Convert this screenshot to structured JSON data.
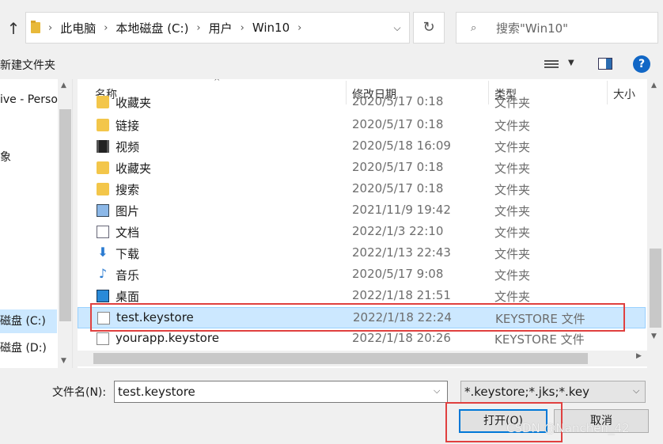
{
  "address": {
    "crumbs": [
      "此电脑",
      "本地磁盘 (C:)",
      "用户",
      "Win10"
    ]
  },
  "search": {
    "placeholder": "搜索\"Win10\""
  },
  "toolbar": {
    "new_folder": "新建文件夹"
  },
  "nav": {
    "items": [
      {
        "label": "ive - Perso"
      },
      {
        "label": "象"
      },
      {
        "label": "磁盘 (C:)",
        "selected": true
      },
      {
        "label": "磁盘 (D:)"
      }
    ]
  },
  "columns": {
    "name": "名称",
    "date": "修改日期",
    "type": "类型",
    "size": "大小"
  },
  "files": [
    {
      "name": "收藏夹",
      "date": "2020/5/17 0:18",
      "type": "文件夹",
      "icon": "folder-star-icon"
    },
    {
      "name": "链接",
      "date": "2020/5/17 0:18",
      "type": "文件夹",
      "icon": "link-folder-icon"
    },
    {
      "name": "视频",
      "date": "2020/5/18 16:09",
      "type": "文件夹",
      "icon": "video-folder-icon"
    },
    {
      "name": "收藏夹",
      "date": "2020/5/17 0:18",
      "type": "文件夹",
      "icon": "favorites-folder-icon"
    },
    {
      "name": "搜索",
      "date": "2020/5/17 0:18",
      "type": "文件夹",
      "icon": "search-folder-icon"
    },
    {
      "name": "图片",
      "date": "2021/11/9 19:42",
      "type": "文件夹",
      "icon": "pictures-folder-icon"
    },
    {
      "name": "文档",
      "date": "2022/1/3 22:10",
      "type": "文件夹",
      "icon": "documents-folder-icon"
    },
    {
      "name": "下载",
      "date": "2022/1/13 22:43",
      "type": "文件夹",
      "icon": "downloads-folder-icon"
    },
    {
      "name": "音乐",
      "date": "2020/5/17 9:08",
      "type": "文件夹",
      "icon": "music-folder-icon"
    },
    {
      "name": "桌面",
      "date": "2022/1/18 21:51",
      "type": "文件夹",
      "icon": "desktop-folder-icon"
    },
    {
      "name": "test.keystore",
      "date": "2022/1/18 22:24",
      "type": "KEYSTORE 文件",
      "icon": "file-icon",
      "selected": true
    },
    {
      "name": "yourapp.keystore",
      "date": "2022/1/18 20:26",
      "type": "KEYSTORE 文件",
      "icon": "file-icon"
    }
  ],
  "footer": {
    "filename_label": "文件名(N):",
    "filename_value": "test.keystore",
    "filter_value": "*.keystore;*.jks;*.key",
    "open_label": "打开(O)",
    "cancel_label": "取消"
  },
  "watermark": "CSDN @Nanchen_42",
  "colors": {
    "selection": "#cce8ff",
    "highlight_box": "#e0403f",
    "accent": "#0078d7"
  }
}
